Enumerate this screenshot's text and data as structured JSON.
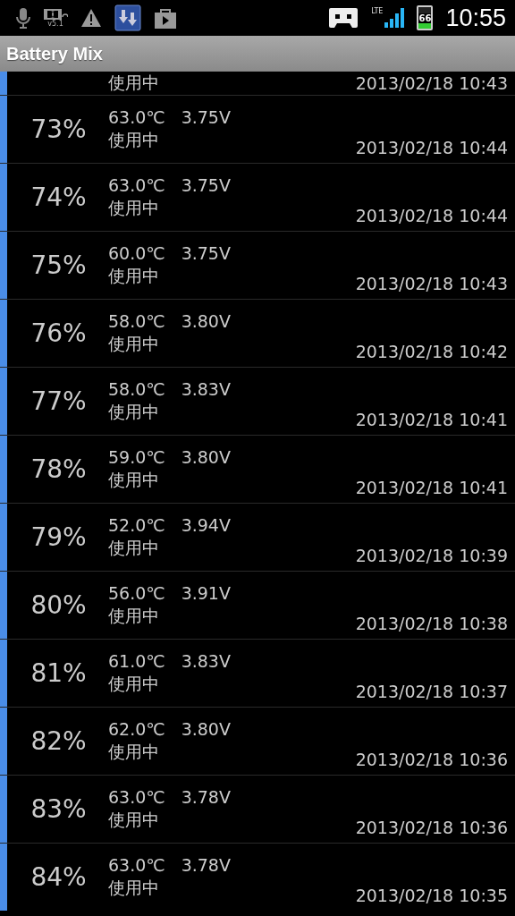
{
  "status_bar": {
    "dolby_label": "v5.1",
    "network_label": "LTE",
    "battery_label": "66",
    "time": "10:55"
  },
  "title": "Battery Mix",
  "partial_row": {
    "status": "使用中",
    "time": "2013/02/18 10:43"
  },
  "rows": [
    {
      "percent": "73%",
      "temp": "63.0℃",
      "voltage": "3.75V",
      "status": "使用中",
      "time": "2013/02/18 10:44"
    },
    {
      "percent": "74%",
      "temp": "63.0℃",
      "voltage": "3.75V",
      "status": "使用中",
      "time": "2013/02/18 10:44"
    },
    {
      "percent": "75%",
      "temp": "60.0℃",
      "voltage": "3.75V",
      "status": "使用中",
      "time": "2013/02/18 10:43"
    },
    {
      "percent": "76%",
      "temp": "58.0℃",
      "voltage": "3.80V",
      "status": "使用中",
      "time": "2013/02/18 10:42"
    },
    {
      "percent": "77%",
      "temp": "58.0℃",
      "voltage": "3.83V",
      "status": "使用中",
      "time": "2013/02/18 10:41"
    },
    {
      "percent": "78%",
      "temp": "59.0℃",
      "voltage": "3.80V",
      "status": "使用中",
      "time": "2013/02/18 10:41"
    },
    {
      "percent": "79%",
      "temp": "52.0℃",
      "voltage": "3.94V",
      "status": "使用中",
      "time": "2013/02/18 10:39"
    },
    {
      "percent": "80%",
      "temp": "56.0℃",
      "voltage": "3.91V",
      "status": "使用中",
      "time": "2013/02/18 10:38"
    },
    {
      "percent": "81%",
      "temp": "61.0℃",
      "voltage": "3.83V",
      "status": "使用中",
      "time": "2013/02/18 10:37"
    },
    {
      "percent": "82%",
      "temp": "62.0℃",
      "voltage": "3.80V",
      "status": "使用中",
      "time": "2013/02/18 10:36"
    },
    {
      "percent": "83%",
      "temp": "63.0℃",
      "voltage": "3.78V",
      "status": "使用中",
      "time": "2013/02/18 10:36"
    },
    {
      "percent": "84%",
      "temp": "63.0℃",
      "voltage": "3.78V",
      "status": "使用中",
      "time": "2013/02/18 10:35"
    }
  ]
}
